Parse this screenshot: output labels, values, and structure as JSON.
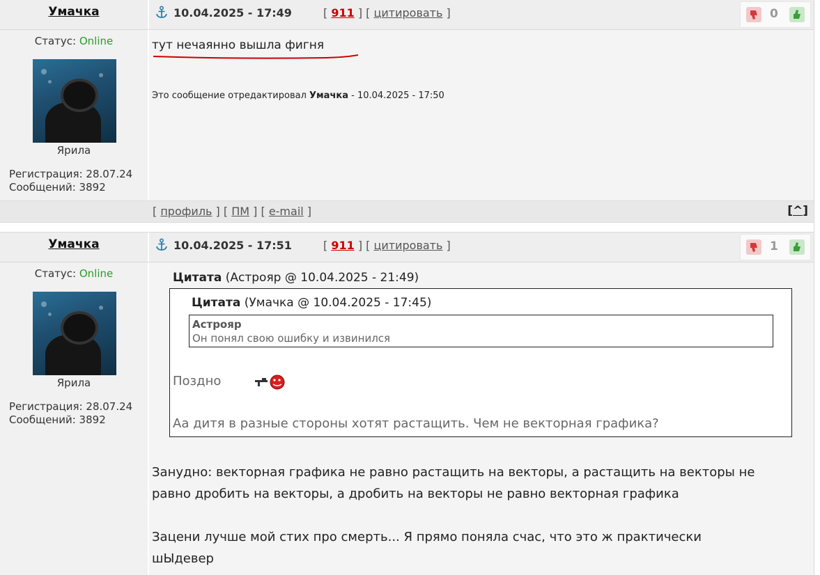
{
  "posts": [
    {
      "author": "Умачка",
      "date": "10.04.2025 - 17:49",
      "post_number": "911",
      "quote_label": "цитировать",
      "rating": "0",
      "status_label": "Статус:",
      "status_value": "Online",
      "user_title": "Ярила",
      "registration": "Регистрация: 28.07.24",
      "messages": "Сообщений: 3892",
      "text": "тут нечаянно вышла фигня",
      "edited_prefix": "Это сообщение отредактировал",
      "edited_by": "Умачка",
      "edited_suffix": "- 10.04.2025 - 17:50",
      "footer": {
        "profile": "профиль",
        "pm": "ПМ",
        "email": "e-mail",
        "top": "^"
      }
    },
    {
      "author": "Умачка",
      "date": "10.04.2025 - 17:51",
      "post_number": "911",
      "quote_label": "цитировать",
      "rating": "1",
      "status_label": "Статус:",
      "status_value": "Online",
      "user_title": "Ярила",
      "registration": "Регистрация: 28.07.24",
      "messages": "Сообщений: 3892",
      "outer_quote": {
        "label": "Цитата",
        "meta": "(Астрояр @ 10.04.2025 - 21:49)",
        "inner_quote": {
          "label": "Цитата",
          "meta": "(Умачка @ 10.04.2025 - 17:45)",
          "author": "Астрояр",
          "text": "Он понял свою ошибку и извинился"
        },
        "late_text": "Поздно",
        "smiley": "gun-smiley",
        "question": "Аа дитя в разные стороны хотят растащить. Чем не векторная графика?"
      },
      "para1": "Занудно: векторная графика не равно растащить на векторы, а растащить на векторы не",
      "para1b": "равно дробить на векторы, а дробить на векторы не равно векторная графика",
      "para2": "Зацени лучше мой стих про смерть... Я прямо поняла счас, что это ж практически",
      "para2b": "шЫдевер"
    }
  ],
  "colors": {
    "online": "#2a9d2a",
    "post_number": "#cc0000",
    "underline": "#cc0000"
  },
  "icons": [
    "anchor-icon",
    "thumb-down-icon",
    "thumb-up-icon",
    "gun-smiley"
  ]
}
